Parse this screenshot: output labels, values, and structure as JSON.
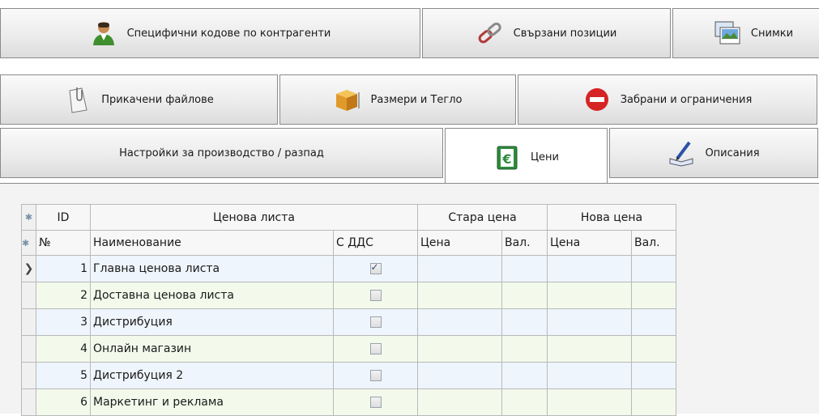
{
  "tabs": {
    "row1": [
      {
        "label": "Специфични кодове по контрагенти",
        "icon": "user-icon"
      },
      {
        "label": "Свързани позиции",
        "icon": "chain-link-icon"
      },
      {
        "label": "Снимки",
        "icon": "pictures-icon"
      }
    ],
    "row2": [
      {
        "label": "Прикачени файлове",
        "icon": "paperclip-document-icon"
      },
      {
        "label": "Размери и Тегло",
        "icon": "box-dimensions-icon"
      },
      {
        "label": "Забрани и ограничения",
        "icon": "no-entry-icon"
      }
    ],
    "row3": [
      {
        "label": "Настройки за производство / разпад"
      },
      {
        "label": "Цени",
        "icon": "euro-price-icon",
        "selected": true
      },
      {
        "label": "Описания",
        "icon": "pen-book-icon"
      }
    ]
  },
  "grid": {
    "header1": {
      "id": "ID",
      "pricelist": "Ценова листа",
      "old_price": "Стара цена",
      "new_price": "Нова цена"
    },
    "header2": {
      "no": "№",
      "name": "Наименование",
      "vat": "С ДДС",
      "old_price": "Цена",
      "old_cur": "Вал.",
      "new_price": "Цена",
      "new_cur": "Вал."
    },
    "rows": [
      {
        "id": "1",
        "name": "Главна ценова листа",
        "vat": true
      },
      {
        "id": "2",
        "name": "Доставна ценова листа",
        "vat": false
      },
      {
        "id": "3",
        "name": "Дистрибуция",
        "vat": false
      },
      {
        "id": "4",
        "name": "Онлайн магазин",
        "vat": false
      },
      {
        "id": "5",
        "name": "Дистрибуция 2",
        "vat": false
      },
      {
        "id": "6",
        "name": "Маркетинг и реклама",
        "vat": false
      }
    ]
  }
}
